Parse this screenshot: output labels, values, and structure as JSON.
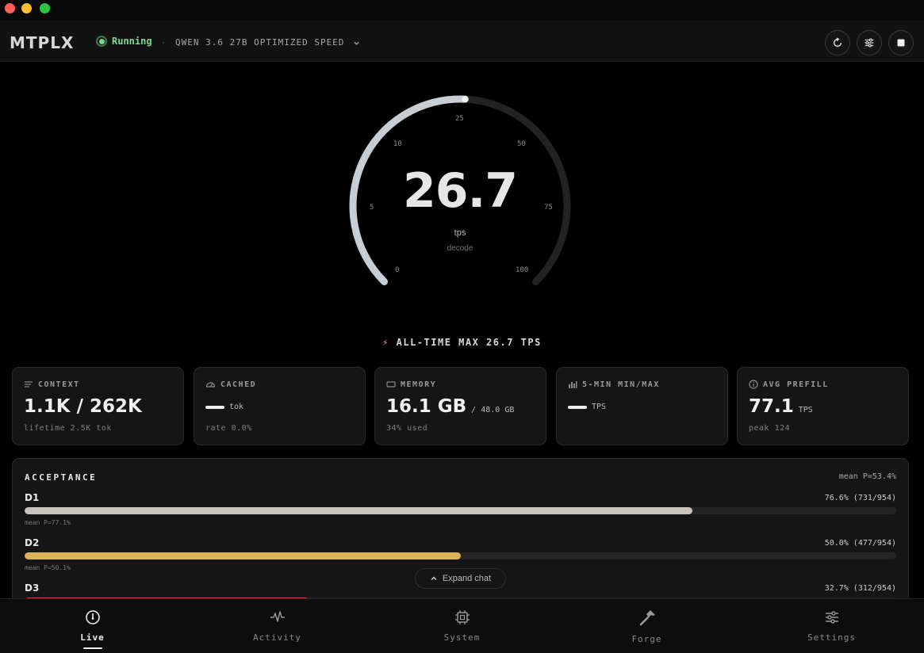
{
  "header": {
    "logo": "MTPLX",
    "status": "Running",
    "separator": "·",
    "model": "QWEN 3.6 27B OPTIMIZED SPEED"
  },
  "gauge": {
    "value": "26.7",
    "unit": "tps",
    "mode": "decode",
    "ticks": [
      "0",
      "5",
      "10",
      "25",
      "50",
      "75",
      "100"
    ],
    "level": 0.51
  },
  "alltime": {
    "bolt": "⚡",
    "label": "ALL-TIME MAX 26.7 TPS"
  },
  "cards": [
    {
      "label": "CONTEXT",
      "value": "1.1K / 262K",
      "unit": "",
      "sub": "lifetime 2.5K tok"
    },
    {
      "label": "CACHED",
      "value": "",
      "unit": "tok",
      "sub": "rate 0.0%"
    },
    {
      "label": "MEMORY",
      "value": "16.1 GB",
      "unit": "/ 48.0 GB",
      "sub": "34% used"
    },
    {
      "label": "5-MIN MIN/MAX",
      "value": "",
      "unit": "TPS",
      "sub": ""
    },
    {
      "label": "AVG PREFILL",
      "value": "77.1",
      "unit": "TPS",
      "sub": "peak 124"
    }
  ],
  "acceptance": {
    "title": "ACCEPTANCE",
    "mean": "mean P=53.4%",
    "rows": [
      {
        "label": "D1",
        "stat": "76.6% (731/954)",
        "fill": 0.766,
        "mean": "mean P=77.1%",
        "color": "#c9c4bb"
      },
      {
        "label": "D2",
        "stat": "50.0% (477/954)",
        "fill": 0.5,
        "mean": "mean P=50.1%",
        "color": "#d9b25a"
      },
      {
        "label": "D3",
        "stat": "32.7% (312/954)",
        "fill": 0.327,
        "mean": "",
        "color": "#c0553a"
      }
    ]
  },
  "expand_chat": "Expand chat",
  "nav": [
    {
      "label": "Live",
      "icon": "speedometer-icon"
    },
    {
      "label": "Activity",
      "icon": "pulse-icon"
    },
    {
      "label": "System",
      "icon": "chip-icon"
    },
    {
      "label": "Forge",
      "icon": "hammer-icon"
    },
    {
      "label": "Settings",
      "icon": "sliders-icon"
    }
  ]
}
